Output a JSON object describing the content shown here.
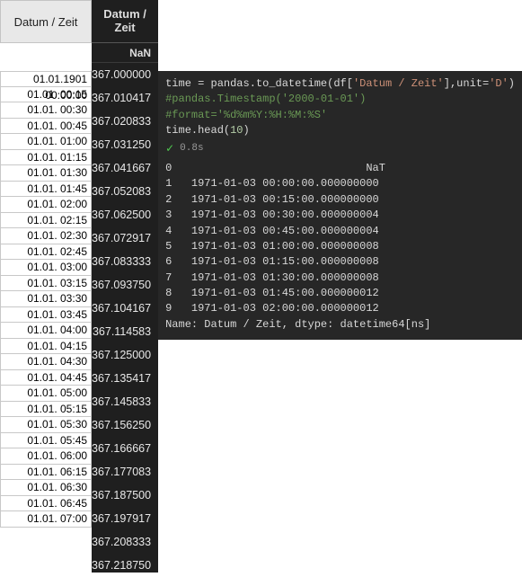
{
  "left": {
    "header": "Datum / Zeit",
    "rows": [
      "01.01.1901 00:00:00",
      "01.01. 00:15",
      "01.01. 00:30",
      "01.01. 00:45",
      "01.01. 01:00",
      "01.01. 01:15",
      "01.01. 01:30",
      "01.01. 01:45",
      "01.01. 02:00",
      "01.01. 02:15",
      "01.01. 02:30",
      "01.01. 02:45",
      "01.01. 03:00",
      "01.01. 03:15",
      "01.01. 03:30",
      "01.01. 03:45",
      "01.01. 04:00",
      "01.01. 04:15",
      "01.01. 04:30",
      "01.01. 04:45",
      "01.01. 05:00",
      "01.01. 05:15",
      "01.01. 05:30",
      "01.01. 05:45",
      "01.01. 06:00",
      "01.01. 06:15",
      "01.01. 06:30",
      "01.01. 06:45",
      "01.01. 07:00"
    ]
  },
  "mid": {
    "header": "Datum / Zeit",
    "nan": "NaN",
    "rows": [
      "367.000000",
      "367.010417",
      "367.020833",
      "367.031250",
      "367.041667",
      "367.052083",
      "367.062500",
      "367.072917",
      "367.083333",
      "367.093750",
      "367.104167",
      "367.114583",
      "367.125000",
      "367.135417",
      "367.145833",
      "367.156250",
      "367.166667",
      "367.177083",
      "367.187500",
      "367.197917",
      "367.208333",
      "367.218750"
    ]
  },
  "code": {
    "line1_pre": "time = pandas.to_datetime(df[",
    "line1_str": "'Datum / Zeit'",
    "line1_mid": "],unit=",
    "line1_unit": "'D'",
    "line1_end": ")",
    "line2": "#pandas.Timestamp('2000-01-01')",
    "line3": "#format='%d%m%Y:%H:%M:%S'",
    "line4_pre": "time.head(",
    "line4_num": "10",
    "line4_end": ")",
    "exec_time": "0.8s"
  },
  "output": {
    "rows": [
      {
        "idx": "0",
        "val": "                           NaT"
      },
      {
        "idx": "1",
        "val": "1971-01-03 00:00:00.000000000"
      },
      {
        "idx": "2",
        "val": "1971-01-03 00:15:00.000000000"
      },
      {
        "idx": "3",
        "val": "1971-01-03 00:30:00.000000004"
      },
      {
        "idx": "4",
        "val": "1971-01-03 00:45:00.000000004"
      },
      {
        "idx": "5",
        "val": "1971-01-03 01:00:00.000000008"
      },
      {
        "idx": "6",
        "val": "1971-01-03 01:15:00.000000008"
      },
      {
        "idx": "7",
        "val": "1971-01-03 01:30:00.000000008"
      },
      {
        "idx": "8",
        "val": "1971-01-03 01:45:00.000000012"
      },
      {
        "idx": "9",
        "val": "1971-01-03 02:00:00.000000012"
      }
    ],
    "footer": "Name: Datum / Zeit, dtype: datetime64[ns]"
  }
}
